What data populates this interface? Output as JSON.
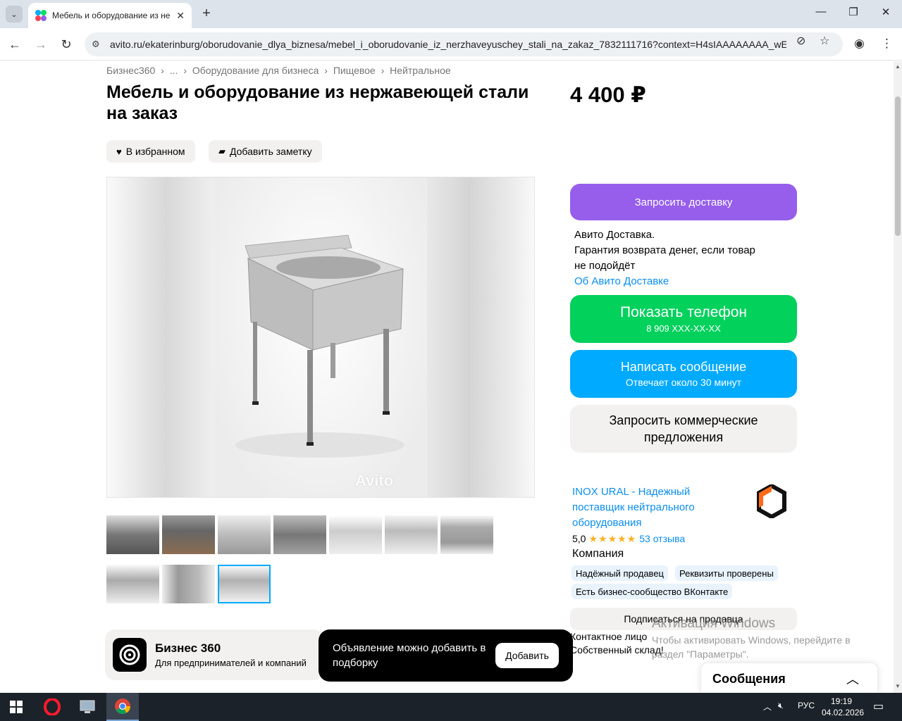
{
  "browser": {
    "tab_title": "Мебель и оборудование из не",
    "url": "avito.ru/ekaterinburg/oborudovanie_dlya_biznesa/mebel_i_oborudovanie_iz_nerzhaveyuschey_stali_na_zakaz_7832111716?context=H4sIAAAAAAAA_wE_A..."
  },
  "breadcrumbs": [
    "Бизнес360",
    "›",
    "...",
    "›",
    "Оборудование для бизнеса",
    "›",
    "Пищевое",
    "›",
    "Нейтральное"
  ],
  "listing": {
    "title": "Мебель и оборудование из нержавеющей стали на заказ",
    "price": "4 400 ₽",
    "favorite_label": "В избранном",
    "note_label": "Добавить заметку",
    "watermark": "Avito"
  },
  "delivery": {
    "request_label": "Запросить доставку",
    "line1": "Авито Доставка.",
    "line2": "Гарантия возврата денег, если товар не подойдёт",
    "link": "Об Авито Доставке"
  },
  "actions": {
    "phone_label": "Показать телефон",
    "phone_number": "8 909 XXX-XX-XX",
    "message_label": "Написать сообщение",
    "message_sub": "Отвечает около 30 минут",
    "commercial_label": "Запросить коммерческие предложения"
  },
  "seller": {
    "name": "INOX URAL - Надежный поставщик нейтрального оборудования",
    "rating": "5,0",
    "stars": "★★★★★",
    "reviews": "53 отзыва",
    "type": "Компания",
    "badges": [
      "Надёжный продавец",
      "Реквизиты проверены",
      "Есть бизнес-сообщество ВКонтакте"
    ],
    "subscribe_label": "Подписаться на продавца",
    "contact_line1": "Контактное лицо",
    "contact_line2": "Собственный склад!"
  },
  "biz360": {
    "title": "Бизнес 360",
    "subtitle": "Для предпринимателей и компаний"
  },
  "toast": {
    "text": "Объявление можно добавить в подборку",
    "button": "Добавить"
  },
  "windows_activation": {
    "title": "Активация Windows",
    "text": "Чтобы активировать Windows, перейдите в раздел \"Параметры\"."
  },
  "messages_panel": {
    "title": "Сообщения"
  },
  "taskbar": {
    "lang": "РУС",
    "time": "19:19",
    "date": "04.02.2026"
  },
  "colors": {
    "delivery_button": "#965eeb",
    "phone_button": "#02d15c",
    "message_button": "#00aaff",
    "link": "#0a8eee"
  }
}
